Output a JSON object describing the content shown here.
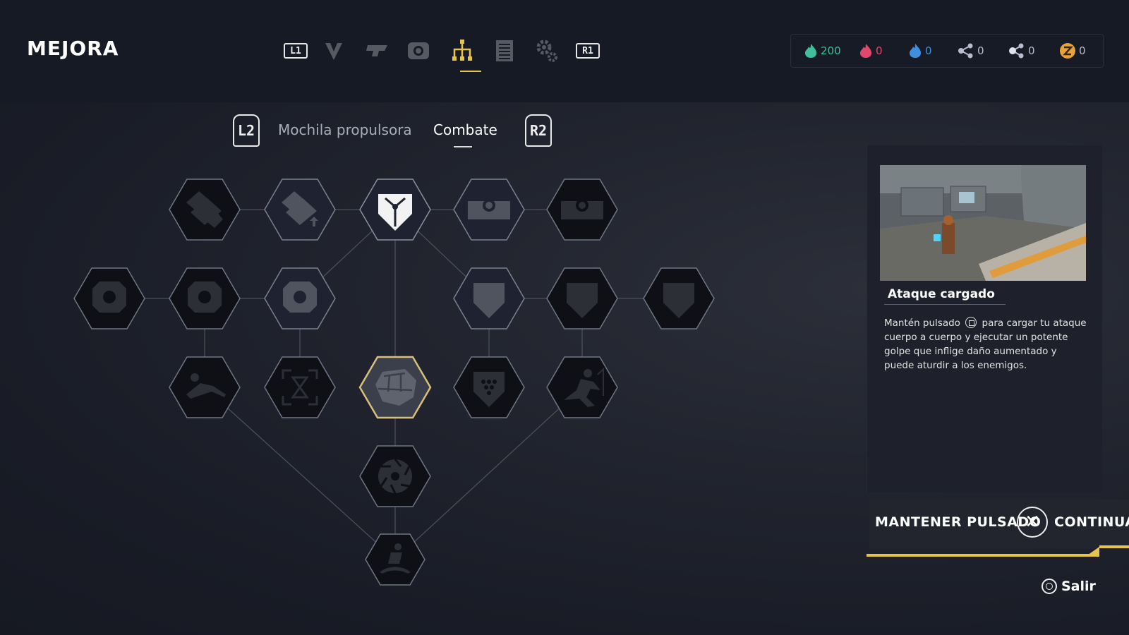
{
  "header": {
    "title": "MEJORA",
    "nav": {
      "left_shoulder": "L1",
      "right_shoulder": "R1",
      "tabs": [
        {
          "icon": "chevron-icon",
          "active": false
        },
        {
          "icon": "weapon-icon",
          "active": false
        },
        {
          "icon": "gadget-icon",
          "active": false
        },
        {
          "icon": "skill-tree-icon",
          "active": true
        },
        {
          "icon": "document-icon",
          "active": false
        },
        {
          "icon": "settings-gear-icon",
          "active": false
        }
      ]
    }
  },
  "currencies": [
    {
      "icon": "green-flame-icon",
      "value": "200",
      "color": "#3fbf9b"
    },
    {
      "icon": "red-flame-icon",
      "value": "0",
      "color": "#e0496c"
    },
    {
      "icon": "blue-flame-icon",
      "value": "0",
      "color": "#3f8fe0"
    },
    {
      "icon": "share-nodes-icon",
      "value": "0",
      "color": "#b7bcd0"
    },
    {
      "icon": "share-nodes-alt-icon",
      "value": "0",
      "color": "#b7bcd0"
    },
    {
      "icon": "z-coin-icon",
      "value": "0",
      "color": "#e8a23a"
    }
  ],
  "subtabs": {
    "left_trigger": "L2",
    "right_trigger": "R2",
    "items": [
      {
        "label": "Mochila propulsora",
        "active": false
      },
      {
        "label": "Combate",
        "active": true
      }
    ]
  },
  "tree": {
    "nodes": [
      {
        "id": "n0",
        "icon": "armor-plates-icon",
        "state": "locked"
      },
      {
        "id": "n1",
        "icon": "armor-plates-upgrade-icon",
        "state": "available"
      },
      {
        "id": "n2",
        "icon": "shield-emblem-icon",
        "state": "unlocked"
      },
      {
        "id": "n3",
        "icon": "machine-upgrade-icon",
        "state": "available"
      },
      {
        "id": "n4",
        "icon": "machine-burst-icon",
        "state": "locked"
      },
      {
        "id": "n5",
        "icon": "helmet-upgrade-icon",
        "state": "locked"
      },
      {
        "id": "n6",
        "icon": "helmet-upgrade-icon",
        "state": "locked"
      },
      {
        "id": "n7",
        "icon": "helmet-upgrade-icon",
        "state": "available"
      },
      {
        "id": "n8",
        "icon": "shield-upgrade-icon",
        "state": "available"
      },
      {
        "id": "n9",
        "icon": "shield-upgrade-icon",
        "state": "locked"
      },
      {
        "id": "n10",
        "icon": "shield-upgrade-icon",
        "state": "locked"
      },
      {
        "id": "n11",
        "icon": "slide-kick-icon",
        "state": "locked"
      },
      {
        "id": "n12",
        "icon": "hourglass-icon",
        "state": "locked"
      },
      {
        "id": "n13",
        "icon": "charged-fist-icon",
        "state": "selected"
      },
      {
        "id": "n14",
        "icon": "honeycomb-burst-icon",
        "state": "locked"
      },
      {
        "id": "n15",
        "icon": "dash-runner-icon",
        "state": "locked"
      },
      {
        "id": "n16",
        "icon": "saw-blade-icon",
        "state": "locked"
      },
      {
        "id": "n17",
        "icon": "ground-slam-icon",
        "state": "locked"
      }
    ],
    "selected_color": "#d9c07a"
  },
  "detail": {
    "skill_name": "Ataque cargado",
    "description_before_button": "Mantén pulsado",
    "description_after_button": "para cargar tu ataque cuerpo a cuerpo y ejecutar un potente golpe que inflige daño aumentado y puede aturdir a los enemigos.",
    "description_button_icon": "square-button-icon"
  },
  "actions": {
    "hold_label": "MANTENER PULSADO",
    "confirm_button_icon": "cross-button-icon",
    "continue_label": "CONTINUAR",
    "exit_label": "Salir",
    "exit_button_icon": "circle-button-icon",
    "accent_color": "#e6c34a"
  }
}
